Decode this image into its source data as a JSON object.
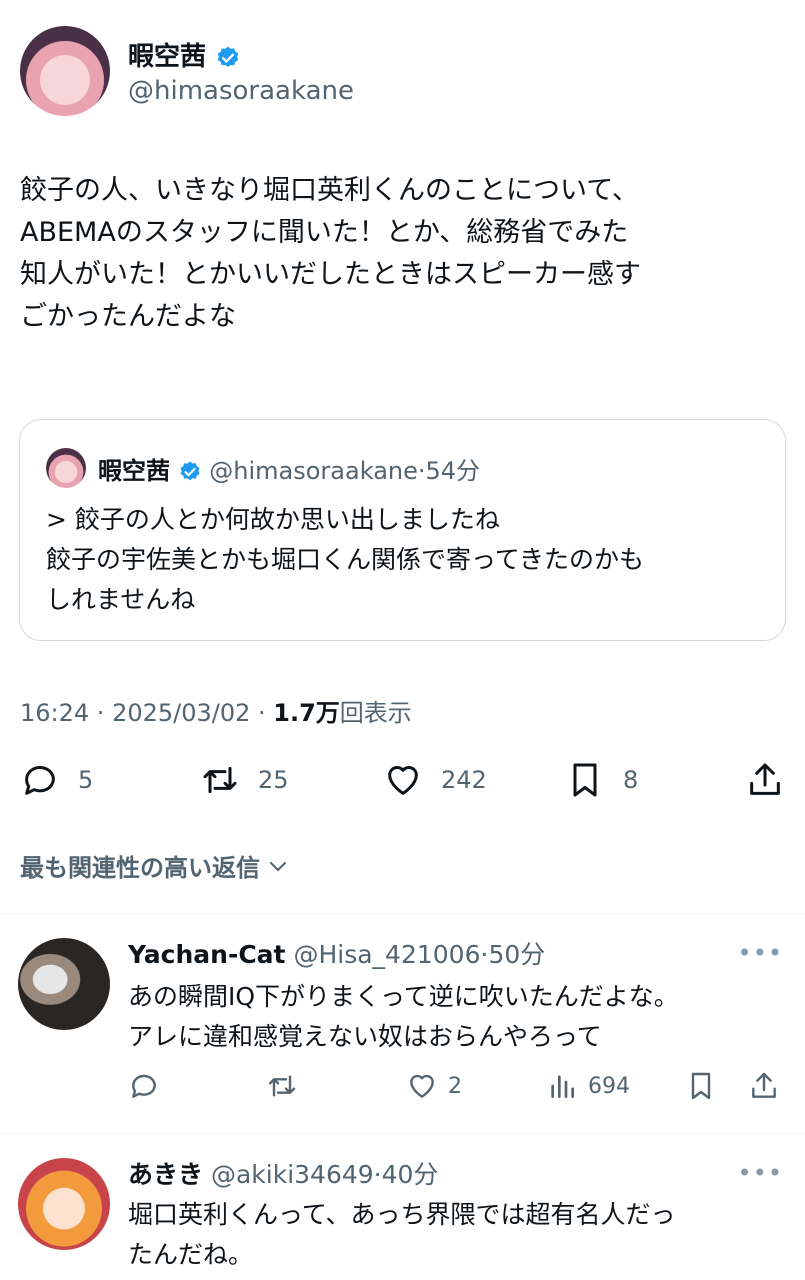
{
  "tweet": {
    "author_name": "暇空茜",
    "author_handle": "@himasoraakane",
    "text": "餃子の人、いきなり堀口英利くんのことについて、\nABEMAのスタッフに聞いた！とか、総務省でみた\n知人がいた！とかいいだしたときはスピーカー感す\nごかったんだよな",
    "quote": {
      "author_name": "暇空茜",
      "author_handle": "@himasoraakane",
      "time": "54分",
      "text": "> 餃子の人とか何故か思い出しましたね\n餃子の宇佐美とかも堀口くん関係で寄ってきたのかも\nしれませんね"
    },
    "time": "16:24",
    "date": "2025/03/02",
    "views_count": "1.7万",
    "views_label": "回表示",
    "stats": {
      "replies": "5",
      "retweets": "25",
      "likes": "242",
      "bookmarks": "8"
    }
  },
  "sort_label": "最も関連性の高い返信",
  "replies": [
    {
      "name": "Yachan-Cat",
      "handle": "@Hisa_421006",
      "time": "50分",
      "text": "あの瞬間IQ下がりまくって逆に吹いたんだよな。\nアレに違和感覚えない奴はおらんやろって",
      "likes": "2",
      "views": "694"
    },
    {
      "name": "あきき",
      "handle": "@akiki34649",
      "time": "40分",
      "text": "堀口英利くんって、あっち界隈では超有名人だっ\nたんだね。"
    }
  ],
  "colors": {
    "verified": "#1d9bf0",
    "secondary_text": "#536471",
    "border": "#cfd9de"
  }
}
